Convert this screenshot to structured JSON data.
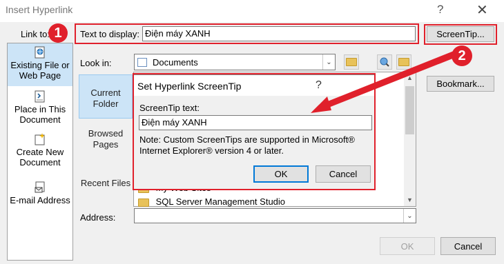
{
  "window": {
    "title": "Insert Hyperlink",
    "help_glyph": "?",
    "close_glyph": "✕"
  },
  "link_to": {
    "label": "Link to:",
    "items": [
      {
        "label": "Existing File or Web Page",
        "icon": "web-page-icon"
      },
      {
        "label": "Place in This Document",
        "icon": "place-document-icon"
      },
      {
        "label": "Create New Document",
        "icon": "new-document-icon"
      },
      {
        "label": "E-mail Address",
        "icon": "email-icon"
      }
    ]
  },
  "text_to_display": {
    "label": "Text to display:",
    "value": "Điện máy XANH"
  },
  "screentip_button": "ScreenTip...",
  "look_in": {
    "label": "Look in:",
    "value": "Documents"
  },
  "places": [
    "Current Folder",
    "Browsed Pages",
    "Recent Files"
  ],
  "files": [
    "My Web Sites",
    "SQL Server Management Studio"
  ],
  "bookmark_button": "Bookmark...",
  "address": {
    "label": "Address:",
    "value": ""
  },
  "ok_button": "OK",
  "cancel_button": "Cancel",
  "screentip_dialog": {
    "title": "Set Hyperlink ScreenTip",
    "help_glyph": "?",
    "field_label": "ScreenTip text:",
    "field_value": "Điện máy XANH",
    "note": "Note: Custom ScreenTips are supported in Microsoft® Internet Explorer® version 4 or later.",
    "ok_label": "OK",
    "cancel_label": "Cancel"
  },
  "annotations": {
    "step1": "1",
    "step2": "2",
    "color": "#e0202b"
  }
}
